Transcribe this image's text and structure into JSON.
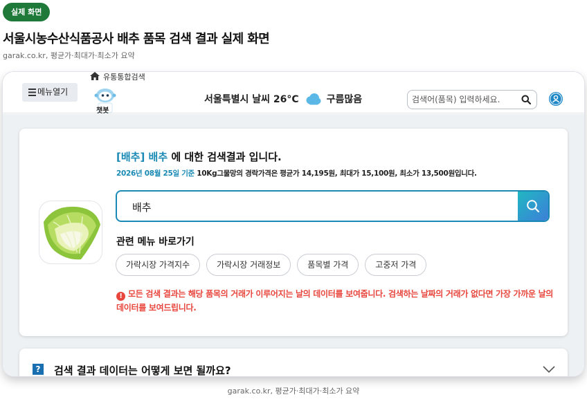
{
  "badge": "실제 화면",
  "heading": {
    "title": "서울시농수산식품공사 배추 품목 검색 결과 실제 화면",
    "subtitle": "garak.co.kr, 평균가·최대가·최소가 요약"
  },
  "topbar": {
    "menu_label": "메뉴열기",
    "breadcrumb": "유통통합검색",
    "bot_label": "챗봇",
    "weather_text": "서울특별시 날씨 26°C",
    "weather_desc": "구름많음",
    "search_placeholder": "검색어(품목) 입력하세요."
  },
  "result": {
    "item_tag": "[배추] 배추",
    "head_suffix": " 에 대한 검색결과 입니다.",
    "date_text": "2026년 08월 25일 기준",
    "summary": " 10Kg그물망의 경락가격은 평균가 14,195원, 최대가 15,100원, 최소가 13,500원입니다.",
    "search_value": "배추",
    "related_title": "관련 메뉴 바로가기",
    "chips": [
      "가락시장 가격지수",
      "가락시장 거래정보",
      "품목별 가격",
      "고중저 가격"
    ],
    "notice": "모든 검색 결과는 해당 품목의 거래가 이루어지는 날의 데이터를 보여줍니다. 검색하는 날짜의 거래가 없다면 가장 가까운 날의 데이터를 보여드립니다."
  },
  "faq": {
    "icon_text": "?",
    "question": "검색 결과 데이터는 어떻게 보면 될까요?"
  },
  "footer": "garak.co.kr, 평균가·최대가·최소가 요약",
  "colors": {
    "accent": "#1a8ab5",
    "badge_green": "#1f7a3a",
    "notice_red": "#e8453c"
  }
}
